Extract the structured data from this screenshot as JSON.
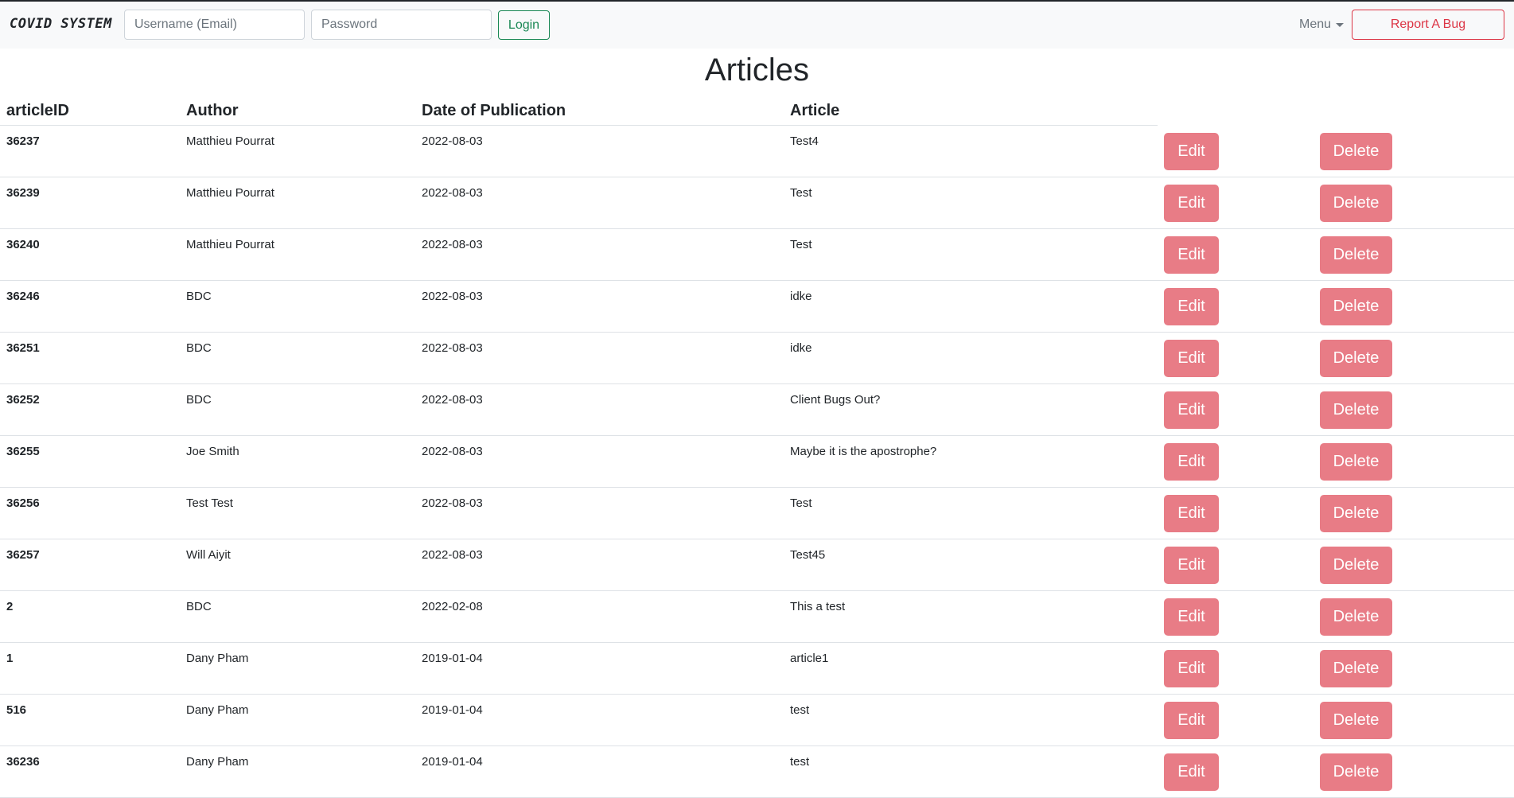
{
  "navbar": {
    "brand": "COVID SYSTEM",
    "username_placeholder": "Username (Email)",
    "password_placeholder": "Password",
    "login_label": "Login",
    "menu_label": "Menu",
    "report_bug_label": "Report A Bug"
  },
  "page": {
    "title": "Articles"
  },
  "table": {
    "columns": [
      "articleID",
      "Author",
      "Date of Publication",
      "Article"
    ],
    "edit_label": "Edit",
    "delete_label": "Delete",
    "rows": [
      {
        "id": "36237",
        "author": "Matthieu Pourrat",
        "date": "2022-08-03",
        "article": "Test4"
      },
      {
        "id": "36239",
        "author": "Matthieu Pourrat",
        "date": "2022-08-03",
        "article": "Test"
      },
      {
        "id": "36240",
        "author": "Matthieu Pourrat",
        "date": "2022-08-03",
        "article": "Test"
      },
      {
        "id": "36246",
        "author": "BDC",
        "date": "2022-08-03",
        "article": "idke"
      },
      {
        "id": "36251",
        "author": "BDC",
        "date": "2022-08-03",
        "article": "idke"
      },
      {
        "id": "36252",
        "author": "BDC",
        "date": "2022-08-03",
        "article": "Client Bugs Out?"
      },
      {
        "id": "36255",
        "author": "Joe Smith",
        "date": "2022-08-03",
        "article": "Maybe it is the apostrophe?"
      },
      {
        "id": "36256",
        "author": "Test Test",
        "date": "2022-08-03",
        "article": "Test"
      },
      {
        "id": "36257",
        "author": "Will Aiyit",
        "date": "2022-08-03",
        "article": "Test45"
      },
      {
        "id": "2",
        "author": "BDC",
        "date": "2022-02-08",
        "article": "This a test"
      },
      {
        "id": "1",
        "author": "Dany Pham",
        "date": "2019-01-04",
        "article": "article1"
      },
      {
        "id": "516",
        "author": "Dany Pham",
        "date": "2019-01-04",
        "article": "test"
      },
      {
        "id": "36236",
        "author": "Dany Pham",
        "date": "2019-01-04",
        "article": "test"
      }
    ]
  }
}
